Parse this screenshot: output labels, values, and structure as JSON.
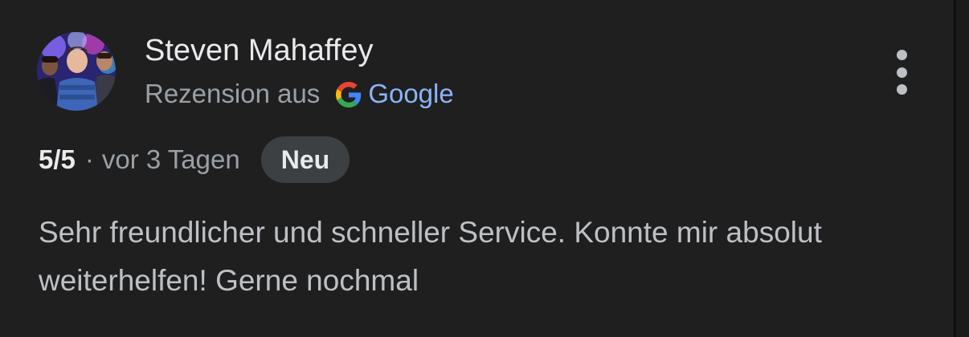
{
  "review": {
    "author_name": "Steven Mahaffey",
    "source_prefix": "Rezension aus",
    "source_name": "Google",
    "rating": "5/5",
    "separator": "·",
    "time_ago": "vor 3 Tagen",
    "badge": "Neu",
    "text": "Sehr freundlicher und schneller Service. Konnte mir absolut weiterhelfen! Gerne nochmal"
  },
  "icons": {
    "avatar": "avatar-photo",
    "source_logo": "google-g-icon",
    "menu": "more-vertical-icon"
  },
  "colors": {
    "background": "#1f1f1f",
    "primary_text": "#e8eaed",
    "secondary_text": "#9aa0a6",
    "link": "#8ab4f8",
    "badge_bg": "#3c4043",
    "google_blue": "#4285F4",
    "google_red": "#EA4335",
    "google_yellow": "#FBBC05",
    "google_green": "#34A853"
  }
}
